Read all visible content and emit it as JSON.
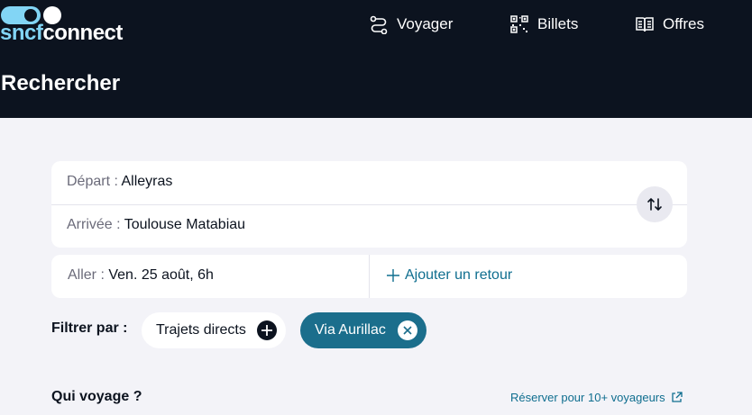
{
  "header": {
    "logo": {
      "part1": "sncf",
      "part2": "connect"
    },
    "nav": [
      {
        "label": "Voyager",
        "icon": "route-icon"
      },
      {
        "label": "Billets",
        "icon": "qr-code-icon"
      },
      {
        "label": "Offres",
        "icon": "open-book-icon"
      }
    ],
    "title": "Rechercher"
  },
  "search": {
    "depart_label": "Départ :",
    "depart_value": "Alleyras",
    "arrivee_label": "Arrivée :",
    "arrivee_value": "Toulouse Matabiau",
    "swap_icon": "swap-vertical-icon",
    "aller_label": "Aller :",
    "aller_value": "Ven. 25 août, 6h",
    "retour_label": "Ajouter un retour"
  },
  "filters": {
    "label": "Filtrer par :",
    "chips": [
      {
        "label": "Trajets directs",
        "icon": "plus-icon",
        "active": false
      },
      {
        "label": "Via Aurillac",
        "icon": "close-icon",
        "active": true
      }
    ]
  },
  "travelers": {
    "title": "Qui voyage ?",
    "group_link": "Réserver pour 10+ voyageurs",
    "group_link_icon": "external-link-icon"
  },
  "colors": {
    "header_bg": "#0c131f",
    "accent": "#1b6e8c",
    "logo_accent": "#82d5f5",
    "page_bg": "#f3f3f8"
  }
}
